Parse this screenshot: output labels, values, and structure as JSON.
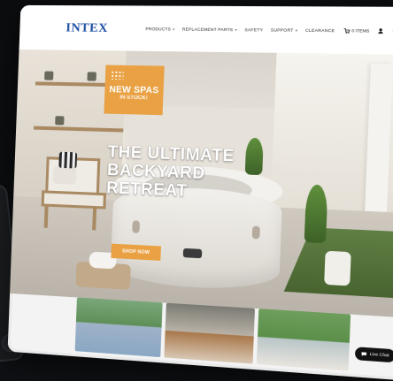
{
  "header": {
    "logo_text": "INTEX",
    "nav": [
      {
        "label": "PRODUCTS",
        "has_dropdown": true
      },
      {
        "label": "REPLACEMENT PARTS",
        "has_dropdown": true
      },
      {
        "label": "SAFETY",
        "has_dropdown": false
      },
      {
        "label": "SUPPORT",
        "has_dropdown": true
      },
      {
        "label": "CLEARANCE",
        "has_dropdown": false
      }
    ],
    "cart_label": "0 ITEMS",
    "icons": {
      "cart": "cart-icon",
      "user": "user-icon",
      "search": "search-icon"
    },
    "colors": {
      "logo": "#1d4fa3",
      "accent": "#e9a143"
    }
  },
  "hero": {
    "badge": {
      "line1": "NEW SPAS",
      "line2": "IN STOCK!"
    },
    "headline": "THE ULTIMATE BACKYARD RETREAT",
    "cta_label": "SHOP NOW"
  },
  "tiles": [
    {
      "name": "tile-pools"
    },
    {
      "name": "tile-lifestyle"
    },
    {
      "name": "tile-spas"
    }
  ],
  "live_chat": {
    "label": "Live Chat"
  }
}
